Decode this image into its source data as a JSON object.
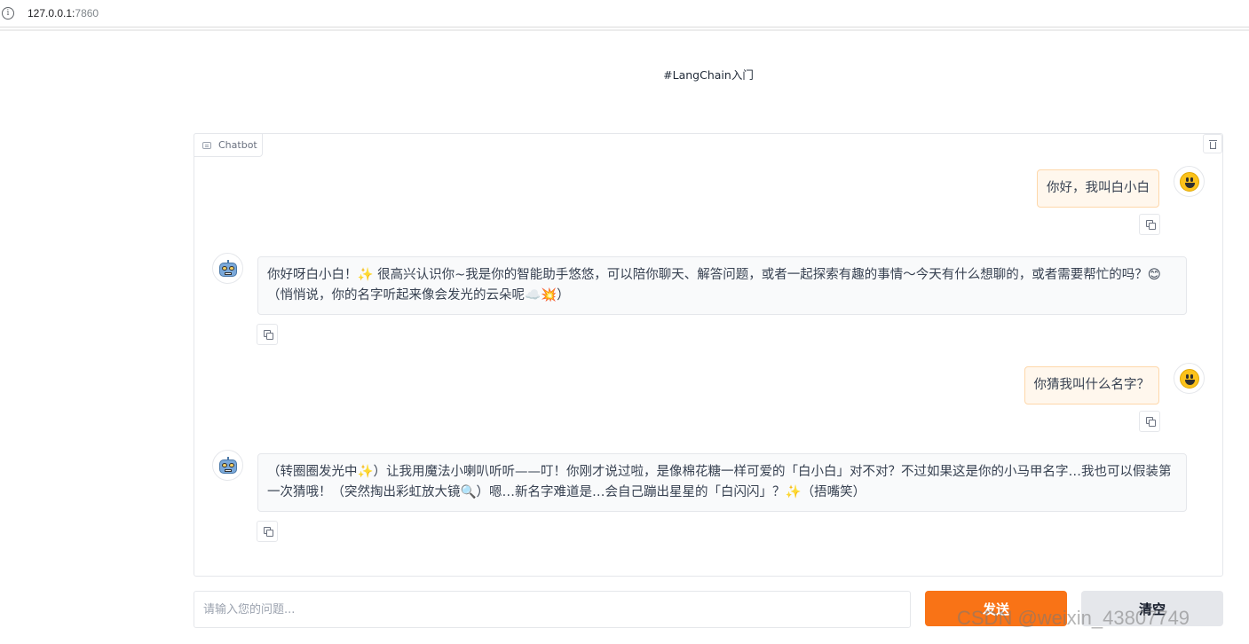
{
  "browser": {
    "url_host": "127.0.0.1:",
    "url_port": "7860"
  },
  "page": {
    "title": "#LangChain入门"
  },
  "chatbot": {
    "label": "Chatbot",
    "messages": [
      {
        "role": "user",
        "text": "你好，我叫白小白"
      },
      {
        "role": "bot",
        "text": "你好呀白小白！✨ 很高兴认识你~我是你的智能助手悠悠，可以陪你聊天、解答问题，或者一起探索有趣的事情～今天有什么想聊的，或者需要帮忙的吗？😊 （悄悄说，你的名字听起来像会发光的云朵呢☁️💥）"
      },
      {
        "role": "user",
        "text": "你猜我叫什么名字？"
      },
      {
        "role": "bot",
        "text": "（转圈圈发光中✨）让我用魔法小喇叭听听——叮！你刚才说过啦，是像棉花糖一样可爱的「白小白」对不对？不过如果这是你的小马甲名字…我也可以假装第一次猜哦！（突然掏出彩虹放大镜🔍）嗯…新名字难道是…会自己蹦出星星的「白闪闪」？✨（捂嘴笑）"
      }
    ]
  },
  "input": {
    "placeholder": "请输入您的问题..."
  },
  "buttons": {
    "send_label": "发送",
    "clear_label": "清空"
  },
  "watermark": {
    "text": "CSDN @weixin_43807749"
  },
  "colors": {
    "accent": "#f97316",
    "user_bubble": "#fff7ed",
    "bot_bubble": "#f9fafb"
  }
}
